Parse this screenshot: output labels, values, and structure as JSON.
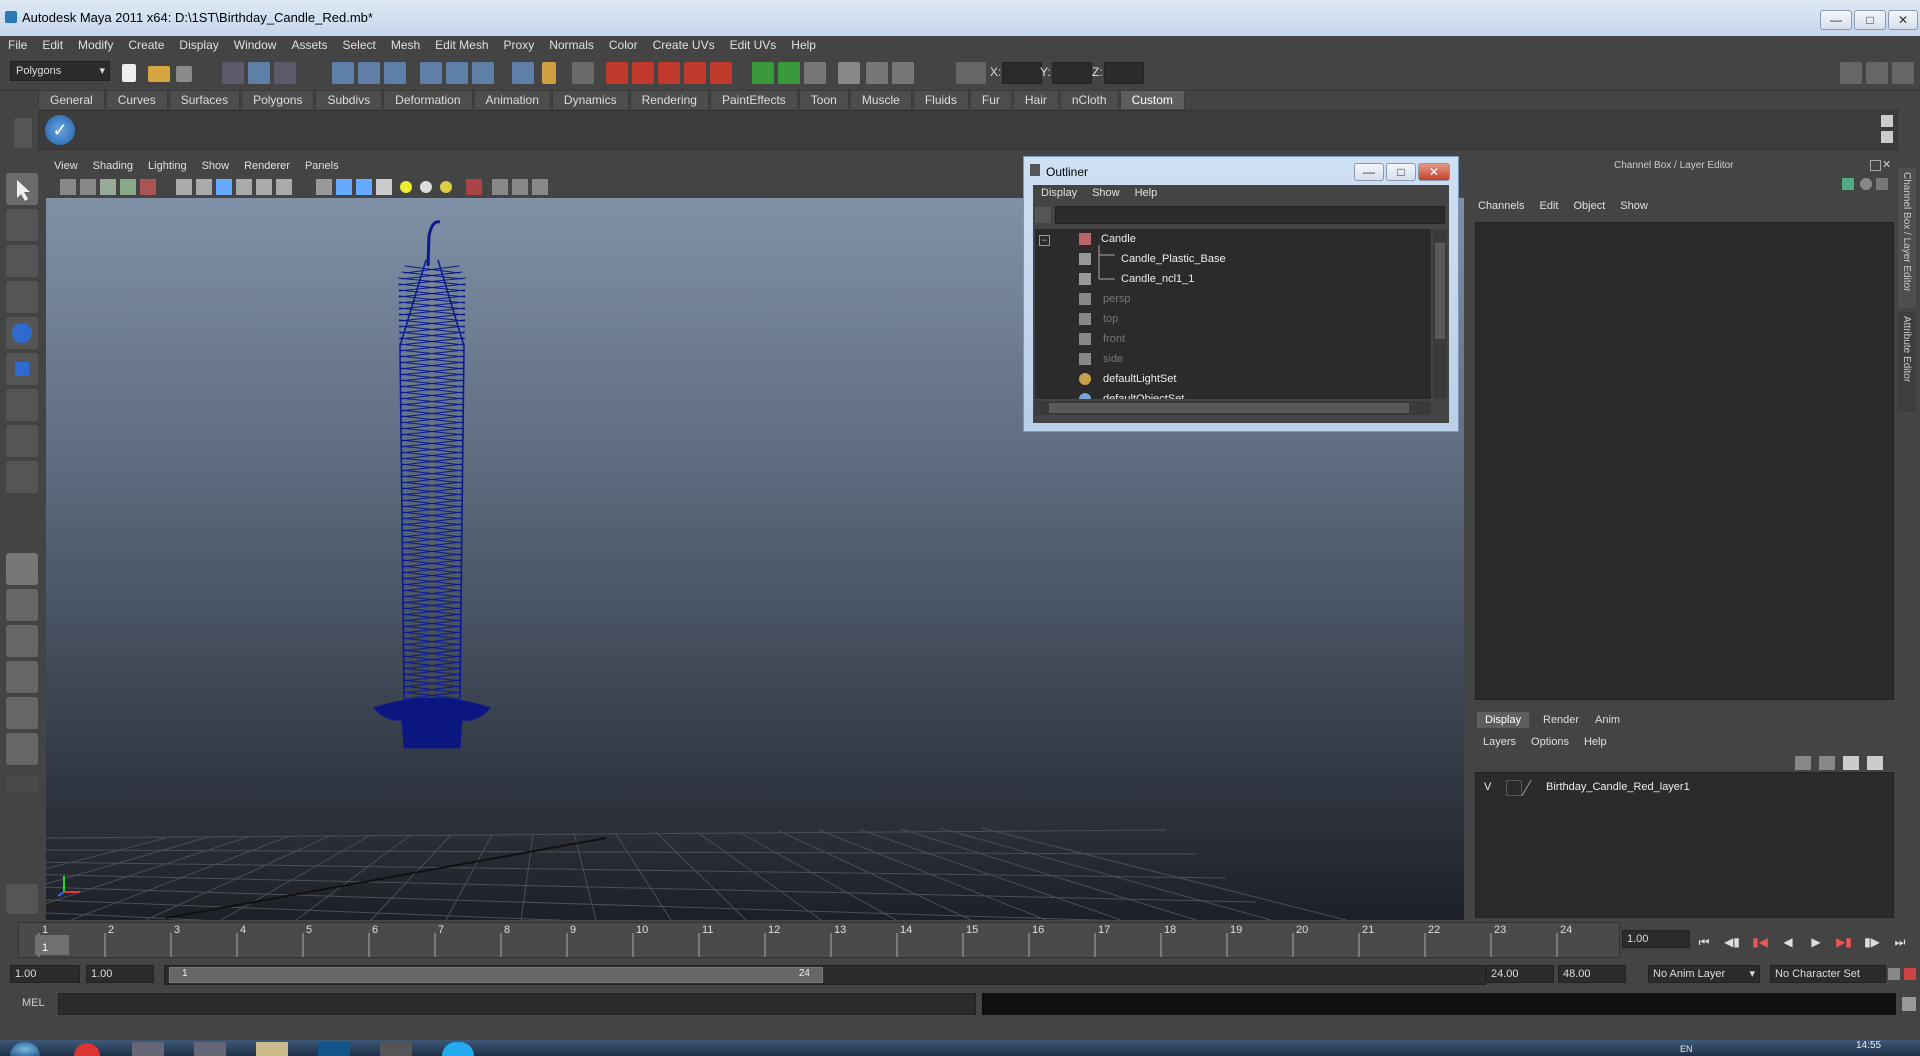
{
  "window": {
    "title": "Autodesk Maya 2011 x64: D:\\1ST\\Birthday_Candle_Red.mb*"
  },
  "menubar": [
    "File",
    "Edit",
    "Modify",
    "Create",
    "Display",
    "Window",
    "Assets",
    "Select",
    "Mesh",
    "Edit Mesh",
    "Proxy",
    "Normals",
    "Color",
    "Create UVs",
    "Edit UVs",
    "Help"
  ],
  "toolbar": {
    "mode": "Polygons",
    "x_label": "X:",
    "y_label": "Y:",
    "z_label": "Z:"
  },
  "shelf": {
    "tabs": [
      "General",
      "Curves",
      "Surfaces",
      "Polygons",
      "Subdivs",
      "Deformation",
      "Animation",
      "Dynamics",
      "Rendering",
      "PaintEffects",
      "Toon",
      "Muscle",
      "Fluids",
      "Fur",
      "Hair",
      "nCloth",
      "Custom"
    ],
    "active": "Custom"
  },
  "viewport": {
    "menu": [
      "View",
      "Shading",
      "Lighting",
      "Show",
      "Renderer",
      "Panels"
    ],
    "wire_color": "#0a1a8c"
  },
  "outliner": {
    "title": "Outliner",
    "menu": [
      "Display",
      "Show",
      "Help"
    ],
    "items": [
      {
        "label": "Candle",
        "dim": false
      },
      {
        "label": "Candle_Plastic_Base",
        "dim": false
      },
      {
        "label": "Candle_ncl1_1",
        "dim": false
      },
      {
        "label": "persp",
        "dim": true
      },
      {
        "label": "top",
        "dim": true
      },
      {
        "label": "front",
        "dim": true
      },
      {
        "label": "side",
        "dim": true
      },
      {
        "label": "defaultLightSet",
        "dim": false
      },
      {
        "label": "defaultObjectSet",
        "dim": false
      }
    ]
  },
  "channelbox": {
    "title": "Channel Box / Layer Editor",
    "menu": [
      "Channels",
      "Edit",
      "Object",
      "Show"
    ],
    "side_tabs": [
      "Channel Box / Layer Editor",
      "Attribute Editor"
    ]
  },
  "layers": {
    "tabs": [
      "Display",
      "Render",
      "Anim"
    ],
    "active_tab": "Display",
    "menu": [
      "Layers",
      "Options",
      "Help"
    ],
    "visible_flag": "V",
    "layer_name": "Birthday_Candle_Red_layer1"
  },
  "timeline": {
    "frames": [
      "1",
      "2",
      "3",
      "4",
      "5",
      "6",
      "7",
      "8",
      "9",
      "10",
      "11",
      "12",
      "13",
      "14",
      "15",
      "16",
      "17",
      "18",
      "19",
      "20",
      "21",
      "22",
      "23",
      "24"
    ],
    "current_frame": "1",
    "current_time": "1.00"
  },
  "range": {
    "start": "1.00",
    "playback_start": "1.00",
    "slider_start": "1",
    "slider_end": "24",
    "playback_end": "24.00",
    "end": "48.00",
    "anim_layer": "No Anim Layer",
    "character_set": "No Character Set"
  },
  "commandline": {
    "label": "MEL"
  },
  "taskbar": {
    "clock": "14:55",
    "lang": "EN"
  }
}
